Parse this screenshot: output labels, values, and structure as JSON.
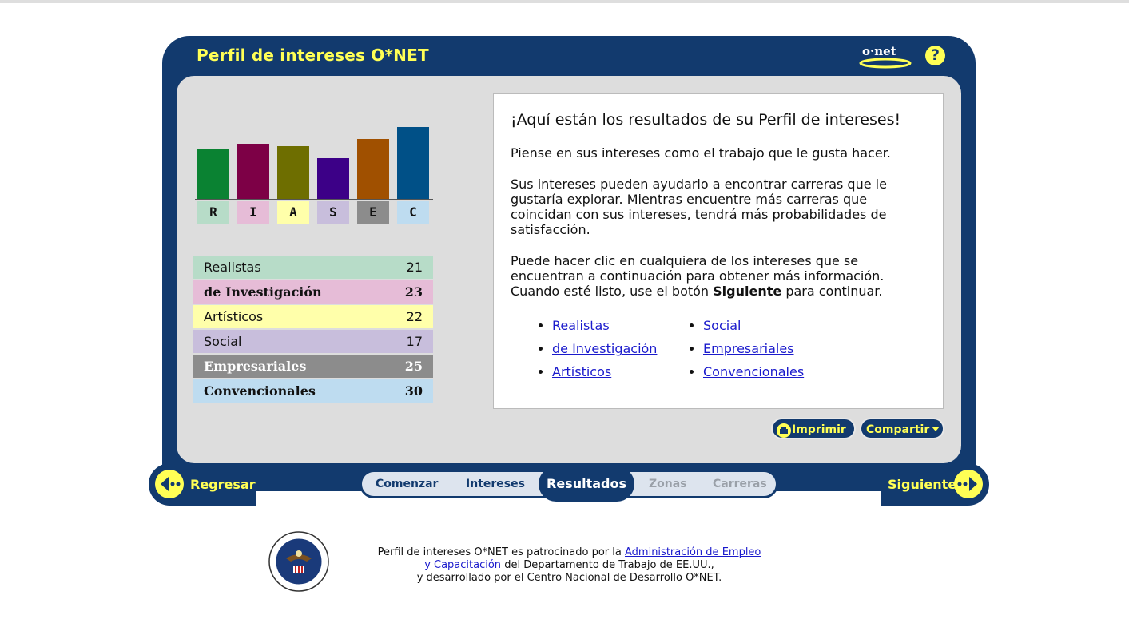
{
  "header": {
    "title": "Perfil de intereses O*NET",
    "logo_text": "o·net",
    "help_symbol": "?"
  },
  "chart_data": {
    "type": "bar",
    "categories": [
      "R",
      "I",
      "A",
      "S",
      "E",
      "C"
    ],
    "values": [
      21,
      23,
      22,
      17,
      25,
      30
    ],
    "colors": [
      "#0a8232",
      "#7d0046",
      "#6e6e00",
      "#3c0087",
      "#a05000",
      "#005087"
    ],
    "label_colors": [
      "#b7dcc8",
      "#e6bcd7",
      "#ffffaa",
      "#c8bedc",
      "#8c8c8c",
      "#bedcf0"
    ],
    "ylim": [
      0,
      30
    ]
  },
  "scores": [
    {
      "name": "Realistas",
      "value": "21",
      "bg": "#b7dcc8",
      "bold": false,
      "color": "#111111"
    },
    {
      "name": "de Investigación",
      "value": "23",
      "bg": "#e6bcd7",
      "bold": true,
      "color": "#111111"
    },
    {
      "name": "Artísticos",
      "value": "22",
      "bg": "#ffffaa",
      "bold": false,
      "color": "#111111"
    },
    {
      "name": "Social",
      "value": "17",
      "bg": "#c8bedc",
      "bold": false,
      "color": "#111111"
    },
    {
      "name": "Empresariales",
      "value": "25",
      "bg": "#8c8c8c",
      "bold": true,
      "color": "#ffffff"
    },
    {
      "name": "Convencionales",
      "value": "30",
      "bg": "#bedcf0",
      "bold": true,
      "color": "#111111"
    }
  ],
  "info": {
    "heading": "¡Aquí están los resultados de su Perfil de intereses!",
    "p1": "Piense en sus intereses como el trabajo que le gusta hacer.",
    "p2": "Sus intereses pueden ayudarlo a encontrar carreras que le gustaría explorar. Mientras encuentre más carreras que coincidan con sus intereses, tendrá más probabilidades de satisfacción.",
    "p3_a": "Puede hacer clic en cualquiera de los intereses que se encuentran a continuación para obtener más información. Cuando esté listo, use el botón ",
    "p3_bold": "Siguiente",
    "p3_b": " para continuar.",
    "links_left": [
      "Realistas",
      "de Investigación",
      "Artísticos"
    ],
    "links_right": [
      "Social",
      "Empresariales",
      "Convencionales"
    ]
  },
  "actions": {
    "print": "Imprimir",
    "share": "Compartir"
  },
  "nav": {
    "back": "Regresar",
    "next": "Siguiente",
    "steps": [
      "Comenzar",
      "Intereses",
      "Resultados",
      "Zonas",
      "Carreras"
    ]
  },
  "footer": {
    "line1_a": "Perfil de intereses O*NET es patrocinado por la ",
    "link": "Administración de Empleo",
    "link2": "y Capacitación",
    "line2_b": " del Departamento de Trabajo de EE.UU.,",
    "line3": "y desarrollado por el Centro Nacional de Desarrollo O*NET."
  }
}
